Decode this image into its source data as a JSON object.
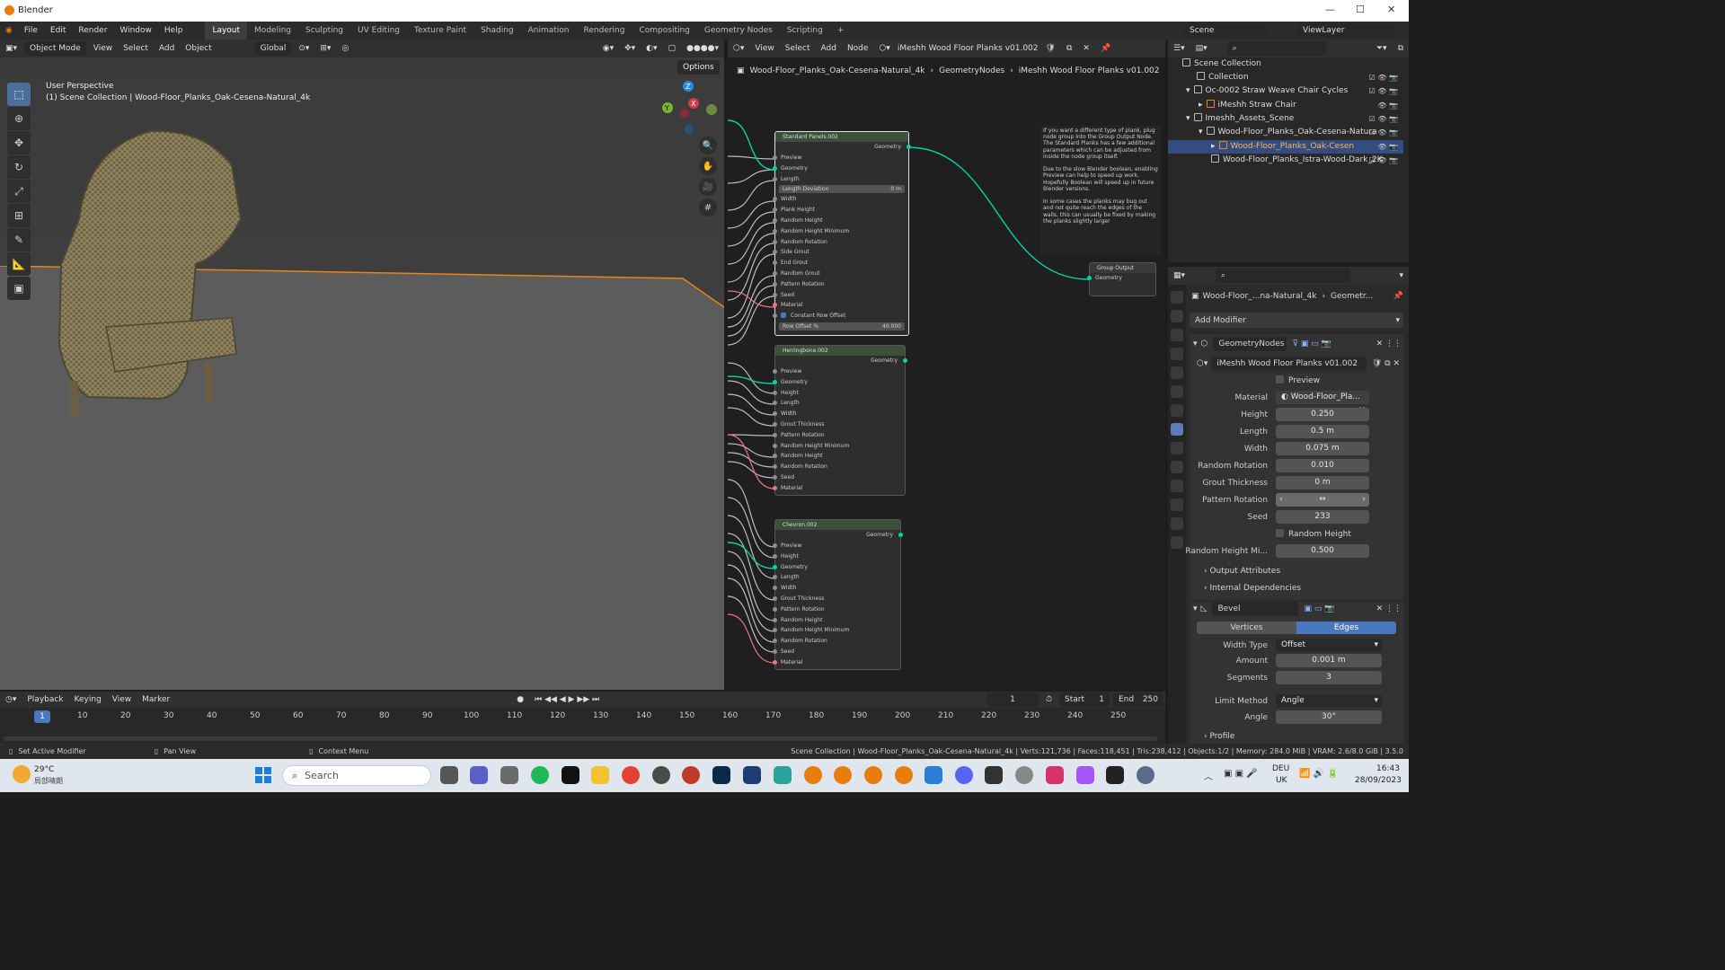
{
  "window": {
    "title": "Blender"
  },
  "menu": [
    "File",
    "Edit",
    "Render",
    "Window",
    "Help"
  ],
  "workspaces": [
    "Layout",
    "Modeling",
    "Sculpting",
    "UV Editing",
    "Texture Paint",
    "Shading",
    "Animation",
    "Rendering",
    "Compositing",
    "Geometry Nodes",
    "Scripting"
  ],
  "active_workspace": "Layout",
  "scene_name": "Scene",
  "view_layer": "ViewLayer",
  "viewport": {
    "mode": "Object Mode",
    "menus": [
      "View",
      "Select",
      "Add",
      "Object"
    ],
    "orientation": "Global",
    "options_label": "Options",
    "title": "User Perspective",
    "subtitle": "(1) Scene Collection | Wood-Floor_Planks_Oak-Cesena-Natural_4k"
  },
  "node_editor": {
    "menus": [
      "View",
      "Select",
      "Add",
      "Node"
    ],
    "node_group": "iMeshh Wood Floor Planks v01.002",
    "breadcrumb": [
      "Wood-Floor_Planks_Oak-Cesena-Natural_4k",
      "GeometryNodes",
      "iMeshh Wood Floor Planks v01.002"
    ],
    "nodes": {
      "standard": {
        "title": "Standard Panels.002",
        "output": "Geometry",
        "inputs": [
          "Preview",
          "Geometry",
          "Length"
        ],
        "length_deviation": {
          "label": "Length Deviation",
          "value": "0 m"
        },
        "inputs2": [
          "Width",
          "Plank Height",
          "Random Height",
          "Random Height Minimum",
          "Random Rotation",
          "Side Grout",
          "End Grout",
          "Random Grout",
          "Pattern Rotation",
          "Seed",
          "Material"
        ],
        "constant_row_offset": "Constant Row Offset",
        "row_offset": {
          "label": "Row Offset %",
          "value": "40.000"
        }
      },
      "herringbone": {
        "title": "Herringbone.002",
        "output": "Geometry",
        "inputs": [
          "Preview",
          "Geometry",
          "Height",
          "Length",
          "Width",
          "Grout Thickness",
          "Pattern Rotation",
          "Random Height Minimum",
          "Random Height",
          "Random Rotation",
          "Seed",
          "Material"
        ]
      },
      "chevron": {
        "title": "Chevron.002",
        "output": "Geometry",
        "inputs": [
          "Preview",
          "Height",
          "Geometry",
          "Length",
          "Width",
          "Grout Thickness",
          "Pattern Rotation",
          "Random Height",
          "Random Height Minimum",
          "Random Rotation",
          "Seed",
          "Material"
        ]
      },
      "group_output": {
        "title": "Group Output",
        "input": "Geometry"
      }
    },
    "note": "If you want a different type of plank, plug node group into the Group Output Node. The Standard Planks has a few additional parameters which can be adjusted from inside the node group itself.\n\nDue to the slow Blender boolean, enabling Preview can help to speed up work. Hopefully Boolean will speed up in future Blender versions.\n\nIn some cases the planks may bug out and not quite reach the edges of the walls, this can usually be fixed by making the planks slightly larger"
  },
  "outliner": {
    "rows": [
      {
        "label": "Scene Collection",
        "indent": 0
      },
      {
        "label": "Collection",
        "indent": 1
      },
      {
        "label": "Oc-0002 Straw Weave Chair Cycles",
        "indent": 1
      },
      {
        "label": "iMeshh Straw Chair",
        "indent": 2
      },
      {
        "label": "Imeshh_Assets_Scene",
        "indent": 1
      },
      {
        "label": "Wood-Floor_Planks_Oak-Cesena-Natura",
        "indent": 2
      },
      {
        "label": "Wood-Floor_Planks_Oak-Cesen",
        "indent": 3,
        "selected": true
      },
      {
        "label": "Wood-Floor_Planks_Istra-Wood-Dark_2K",
        "indent": 2
      }
    ]
  },
  "properties": {
    "breadcrumb": [
      "Wood-Floor_...na-Natural_4k",
      "Geometr..."
    ],
    "add_modifier": "Add Modifier",
    "gn_modifier": {
      "name": "GeometryNodes",
      "node_group": "iMeshh Wood Floor Planks v01.002",
      "preview": "Preview",
      "material": {
        "label": "Material",
        "value": "Wood-Floor_Pla..."
      },
      "fields": [
        {
          "label": "Height",
          "value": "0.250"
        },
        {
          "label": "Length",
          "value": "0.5 m"
        },
        {
          "label": "Width",
          "value": "0.075 m"
        },
        {
          "label": "Random Rotation",
          "value": "0.010"
        },
        {
          "label": "Grout Thickness",
          "value": "0 m"
        },
        {
          "label": "Pattern Rotation",
          "value": ""
        },
        {
          "label": "Seed",
          "value": "233"
        }
      ],
      "random_height": "Random Height",
      "random_height_min": {
        "label": "Random Height Mi...",
        "value": "0.500"
      },
      "output_attributes": "Output Attributes",
      "internal_dependencies": "Internal Dependencies"
    },
    "bevel": {
      "name": "Bevel",
      "tabs": [
        "Vertices",
        "Edges"
      ],
      "active_tab": "Edges",
      "fields": [
        {
          "label": "Width Type",
          "value": "Offset"
        },
        {
          "label": "Amount",
          "value": "0.001 m"
        },
        {
          "label": "Segments",
          "value": "3"
        },
        {
          "label": "Limit Method",
          "value": "Angle"
        },
        {
          "label": "Angle",
          "value": "30°"
        }
      ],
      "profile": "Profile"
    }
  },
  "timeline": {
    "menus": [
      "Playback",
      "Keying",
      "View",
      "Marker"
    ],
    "current_frame": "1",
    "start_label": "Start",
    "start": "1",
    "end_label": "End",
    "end": "250",
    "ticks": [
      "10",
      "20",
      "30",
      "40",
      "50",
      "60",
      "70",
      "80",
      "90",
      "100",
      "110",
      "120",
      "130",
      "140",
      "150",
      "160",
      "170",
      "180",
      "190",
      "200",
      "210",
      "220",
      "230",
      "240",
      "250"
    ]
  },
  "status": {
    "left1": "Set Active Modifier",
    "left2": "Pan View",
    "left3": "Context Menu",
    "right": "Scene Collection | Wood-Floor_Planks_Oak-Cesena-Natural_4k | Verts:121,736 | Faces:118,451 | Tris:238,412 | Objects:1/2 | Memory: 284.0 MiB | VRAM: 2.6/8.0 GiB | 3.5.0"
  },
  "taskbar": {
    "weather_temp": "29°C",
    "weather_desc": "局部晴朗",
    "search": "Search",
    "lang1": "DEU",
    "lang2": "UK",
    "time": "16:43",
    "date": "28/09/2023"
  },
  "colors": {
    "accent": "#4a78c0",
    "selection": "#334d80",
    "geometry_socket": "#00d6a3",
    "material_socket": "#eb7582",
    "floor_outline": "#e8841a"
  }
}
